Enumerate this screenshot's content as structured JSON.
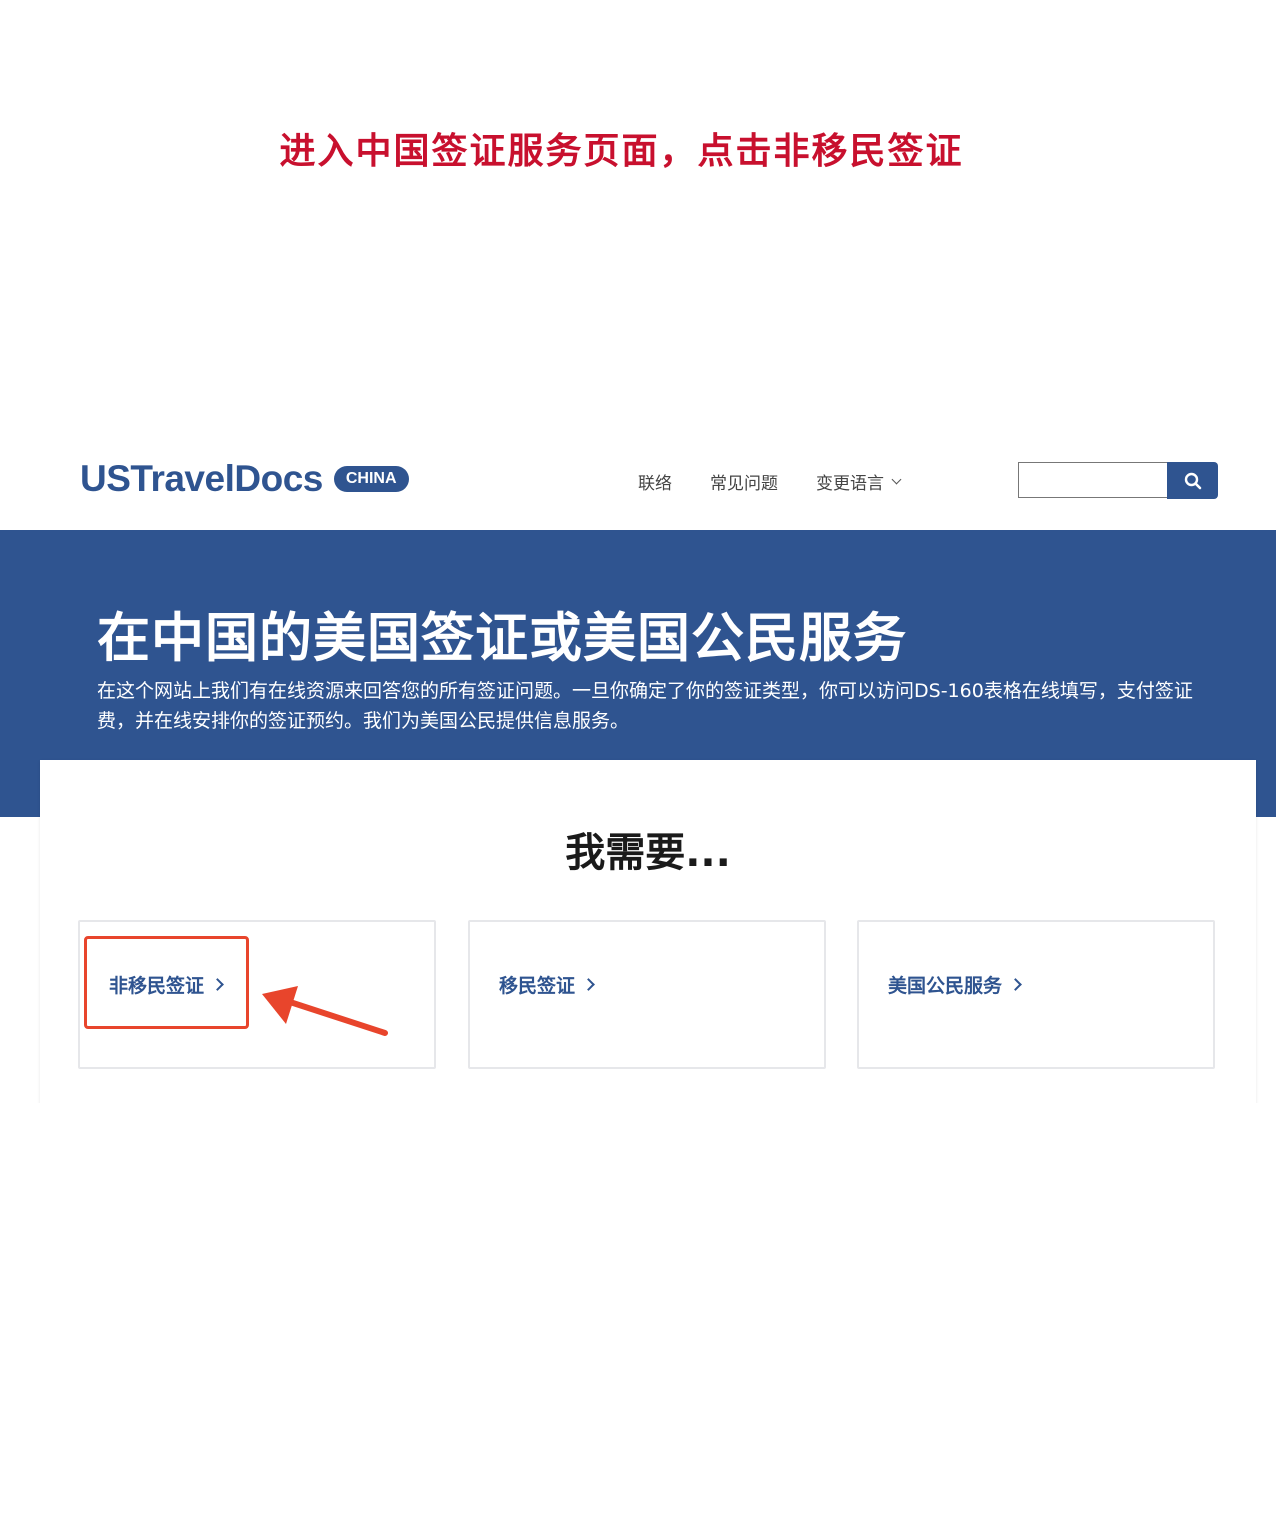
{
  "instruction": "进入中国签证服务页面，点击非移民签证",
  "header": {
    "logo_text": "USTravelDocs",
    "logo_badge": "CHINA",
    "nav": [
      "联络",
      "常见问题",
      "变更语言"
    ],
    "search_placeholder": "",
    "search_icon": "search-icon"
  },
  "hero": {
    "title": "在中国的美国签证或美国公民服务",
    "description": "在这个网站上我们有在线资源来回答您的所有签证问题。一旦你确定了你的签证类型，你可以访问DS-160表格在线填写，支付签证费，并在线安排你的签证预约。我们为美国公民提供信息服务。"
  },
  "options": {
    "heading": "我需要...",
    "items": [
      "非移民签证",
      "移民签证",
      "美国公民服务"
    ]
  },
  "colors": {
    "brand": "#2f5490",
    "instruction": "#c8102e",
    "highlight": "#e8452c"
  }
}
